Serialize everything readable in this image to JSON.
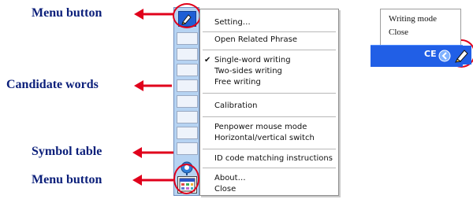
{
  "callouts": {
    "menu_button_top": "Menu button",
    "candidate_words": "Candidate words",
    "symbol_table": "Symbol table",
    "menu_button_bottom": "Menu button"
  },
  "context_menu": {
    "items": [
      "Setting…",
      "Open Related Phrase",
      "Single-word writing",
      "Two-sides writing",
      "Free writing",
      "Calibration",
      "Penpower mouse mode",
      "Horizontal/vertical switch",
      "ID code matching instructions",
      "About…",
      "Close"
    ]
  },
  "tray_menu": {
    "items": [
      "Writing mode",
      "Close"
    ],
    "tray_text": "CE"
  },
  "colors": {
    "callout_text": "#0b1f7a",
    "arrow_red": "#e0001b",
    "toolbar_bg": "#b6d3f2",
    "taskbar_blue": "#215fe6"
  },
  "icons": {
    "menu_button_top": "pen-icon",
    "symbol_table": "symbol-table-icon",
    "menu_button_bottom": "menu-grid-icon",
    "tray_pen": "pen-icon"
  }
}
